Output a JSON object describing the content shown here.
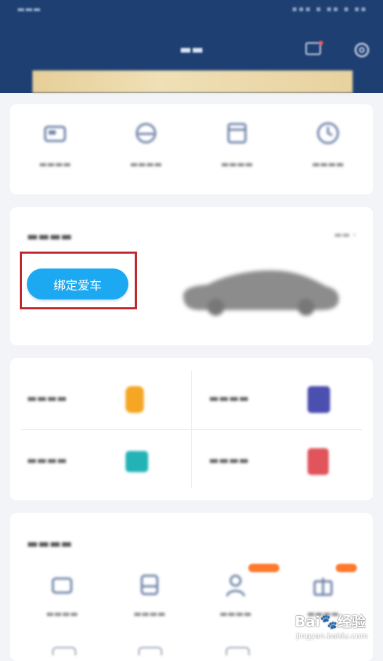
{
  "colors": {
    "header_bg": "#1e3f72",
    "primary_button": "#1da9f2",
    "highlight_box": "#c0262d",
    "banner_gold": "#e6cf98",
    "tag_orange": "#ff7a2d",
    "page_bg": "#f2f4f8"
  },
  "mycar": {
    "bind_button": "绑定爱车",
    "car_image": "car-silhouette"
  },
  "watermark": {
    "brand": "Bai",
    "paw": "paw-icon",
    "word": "经验",
    "url": "jingyan.baidu.com"
  },
  "icons": {
    "orders": [
      "car-order-icon",
      "helmet-order-icon",
      "calendar-order-icon",
      "clock-order-icon"
    ],
    "services": [
      "coin-icon",
      "card-icon",
      "wallet-icon",
      "mailbox-icon"
    ],
    "apps": [
      "message-icon",
      "bus-icon",
      "person-icon",
      "gift-icon"
    ],
    "header": [
      "message-box-icon",
      "gear-icon"
    ]
  }
}
